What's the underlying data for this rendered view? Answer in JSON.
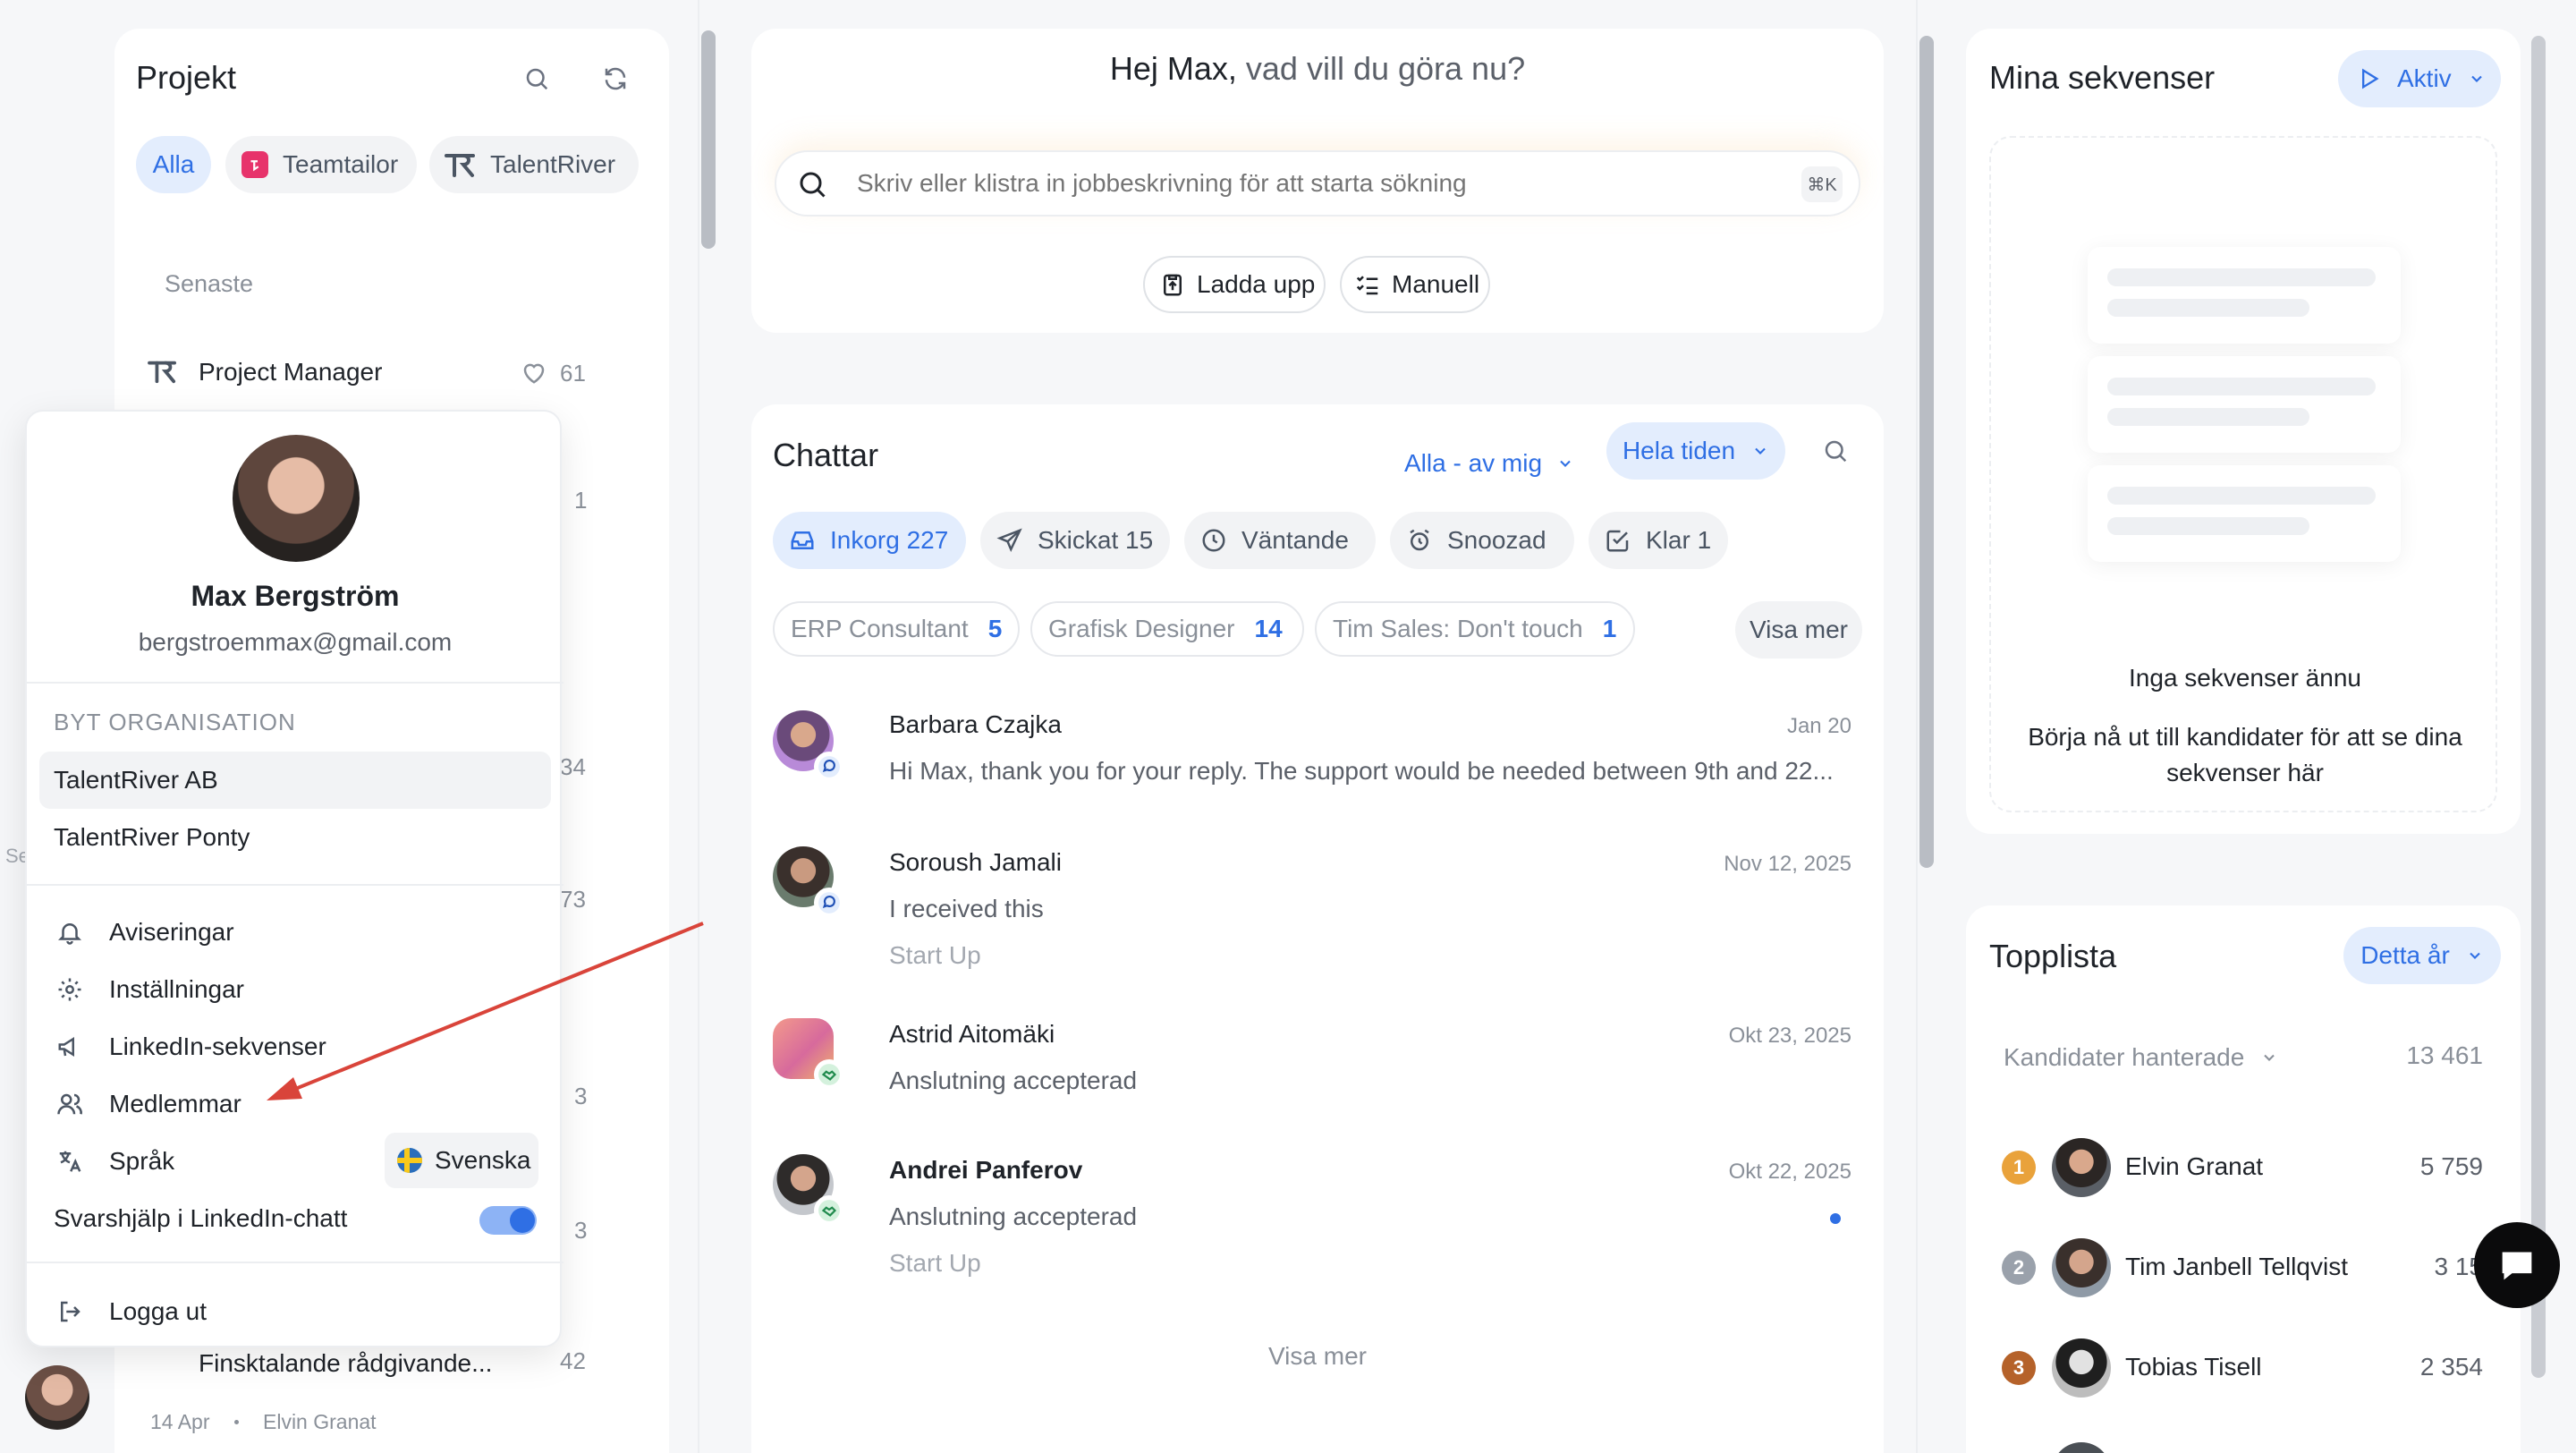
{
  "projects": {
    "title": "Projekt",
    "filters": [
      {
        "label": "Alla",
        "active": true
      },
      {
        "label": "Teamtailor",
        "active": false
      },
      {
        "label": "TalentRiver",
        "active": false
      }
    ],
    "section_label": "Senaste",
    "first_item": {
      "name": "Project Manager",
      "likes": "61"
    },
    "side_counts": [
      "1",
      "34",
      "73",
      "3",
      "3",
      "42"
    ],
    "last_item": {
      "name": "Finsktalande rådgivande...",
      "date": "14 Apr",
      "owner": "Elvin Granat"
    },
    "partial_label": "Se"
  },
  "search": {
    "greeting_name": "Hej Max,",
    "greeting_rest": " vad vill du göra nu?",
    "placeholder": "Skriv eller klistra in jobbeskrivning för att starta sökning",
    "shortcut": "⌘K",
    "upload_label": "Ladda upp",
    "manual_label": "Manuell"
  },
  "chats": {
    "title": "Chattar",
    "filter_owner": "Alla - av mig",
    "filter_time": "Hela tiden",
    "tabs": [
      {
        "label": "Inkorg 227",
        "icon": "inbox-icon",
        "active": true
      },
      {
        "label": "Skickat 15",
        "icon": "send-icon",
        "active": false
      },
      {
        "label": "Väntande",
        "icon": "clock-icon",
        "active": false
      },
      {
        "label": "Snoozad",
        "icon": "alarm-icon",
        "active": false
      },
      {
        "label": "Klar 1",
        "icon": "checkbox-icon",
        "active": false
      }
    ],
    "projects": [
      {
        "label": "ERP Consultant",
        "count": "5"
      },
      {
        "label": "Grafisk Designer",
        "count": "14"
      },
      {
        "label": "Tim Sales: Don't touch",
        "count": "1"
      }
    ],
    "more_projects": "Visa mer",
    "messages": [
      {
        "name": "Barbara Czajka",
        "date": "Jan 20",
        "preview": "Hi Max, thank you for your reply. The support would be needed between 9th and 22...",
        "sub": "",
        "badge": "chat",
        "bold": false
      },
      {
        "name": "Soroush Jamali",
        "date": "Nov 12, 2025",
        "preview": "I received this",
        "sub": "Start Up",
        "badge": "chat",
        "bold": false
      },
      {
        "name": "Astrid Aitomäki",
        "date": "Okt 23, 2025",
        "preview": "Anslutning accepterad",
        "sub": "",
        "badge": "handshake",
        "bold": false
      },
      {
        "name": "Andrei Panferov",
        "date": "Okt 22, 2025",
        "preview": "Anslutning accepterad",
        "sub": "Start Up",
        "badge": "handshake",
        "bold": true
      }
    ],
    "show_more": "Visa mer"
  },
  "sequences": {
    "title": "Mina sekvenser",
    "status": "Aktiv",
    "empty_title": "Inga sekvenser ännu",
    "empty_text": "Börja nå ut till kandidater för att se dina sekvenser här"
  },
  "leaderboard": {
    "title": "Topplista",
    "period": "Detta år",
    "metric": "Kandidater hanterade",
    "total": "13 461",
    "rows": [
      {
        "rank": "1",
        "name": "Elvin Granat",
        "value": "5 759",
        "color": "#e9a23b"
      },
      {
        "rank": "2",
        "name": "Tim Janbell Tellqvist",
        "value": "3 15",
        "color": "#9aa1ab"
      },
      {
        "rank": "3",
        "name": "Tobias Tisell",
        "value": "2 354",
        "color": "#b5622a"
      }
    ]
  },
  "profile_menu": {
    "name": "Max Bergström",
    "email": "bergstroemmax@gmail.com",
    "org_heading": "BYT ORGANISATION",
    "orgs": [
      {
        "label": "TalentRiver AB",
        "selected": true
      },
      {
        "label": "TalentRiver Ponty",
        "selected": false
      }
    ],
    "items": [
      {
        "label": "Aviseringar",
        "icon": "bell-icon"
      },
      {
        "label": "Inställningar",
        "icon": "gear-icon"
      },
      {
        "label": "LinkedIn-sekvenser",
        "icon": "megaphone-icon"
      },
      {
        "label": "Medlemmar",
        "icon": "users-icon"
      },
      {
        "label": "Språk",
        "icon": "translate-icon"
      }
    ],
    "language": "Svenska",
    "reply_help": "Svarshjälp i LinkedIn-chatt",
    "reply_help_on": true,
    "logout": "Logga ut"
  },
  "colors": {
    "accent": "#2f6fe4",
    "accent_bg": "#e3edfd",
    "annotation_arrow": "#d9443a"
  }
}
